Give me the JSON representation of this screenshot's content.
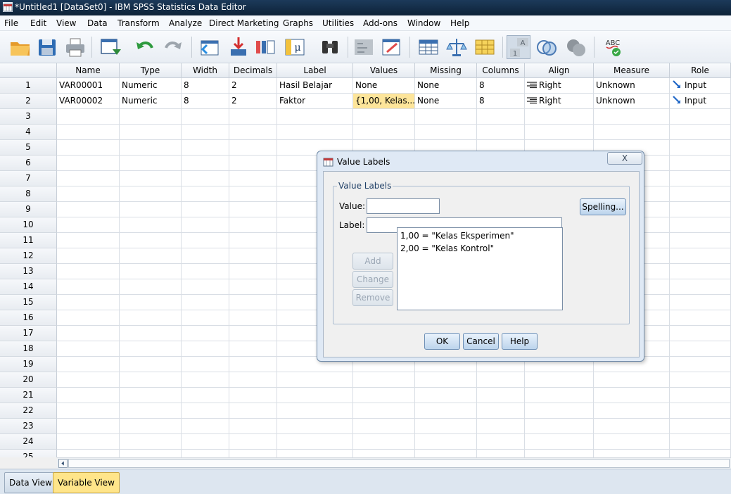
{
  "window": {
    "title": "*Untitled1 [DataSet0] - IBM SPSS Statistics Data Editor"
  },
  "menu": [
    "File",
    "Edit",
    "View",
    "Data",
    "Transform",
    "Analyze",
    "Direct Marketing",
    "Graphs",
    "Utilities",
    "Add-ons",
    "Window",
    "Help"
  ],
  "toolbar": {
    "buttons": [
      "open-folder",
      "save",
      "print",
      "dialog-recall",
      "undo",
      "redo",
      "go-to-case",
      "go-to-variable",
      "variables",
      "descriptive-statistics",
      "find",
      "insert-cases",
      "insert-variable",
      "split-file",
      "weight-cases",
      "select-cases",
      "value-labels",
      "use-sets",
      "show-all-variables",
      "spell-check"
    ]
  },
  "grid": {
    "columns": [
      "Name",
      "Type",
      "Width",
      "Decimals",
      "Label",
      "Values",
      "Missing",
      "Columns",
      "Align",
      "Measure",
      "Role"
    ],
    "rows": [
      [
        "VAR00001",
        "Numeric",
        "8",
        "2",
        "Hasil Belajar",
        "None",
        "None",
        "8",
        "Right",
        "Unknown",
        "Input"
      ],
      [
        "VAR00002",
        "Numeric",
        "8",
        "2",
        "Faktor",
        "{1,00, Kelas...",
        "None",
        "8",
        "Right",
        "Unknown",
        "Input"
      ]
    ],
    "row_numbers": [
      "1",
      "2",
      "3",
      "4",
      "5",
      "6",
      "7",
      "8",
      "9",
      "10",
      "11",
      "12",
      "13",
      "14",
      "15",
      "16",
      "17",
      "18",
      "19",
      "20",
      "21",
      "22",
      "23",
      "24",
      "25"
    ]
  },
  "tabs": {
    "data_view": "Data View",
    "variable_view": "Variable View"
  },
  "dialog": {
    "title": "Value Labels",
    "close_glyph": "X",
    "group_label": "Value Labels",
    "value_label": "Value:",
    "value_text": "",
    "label_label": "Label:",
    "label_text": "",
    "spelling": "Spelling...",
    "list": [
      "1,00 = \"Kelas Eksperimen\"",
      "2,00 = \"Kelas Kontrol\""
    ],
    "add": "Add",
    "change": "Change",
    "remove": "Remove",
    "ok": "OK",
    "cancel": "Cancel",
    "help": "Help"
  },
  "colors": {
    "highlight": "#fde59a",
    "active_tab": "#ffe58a",
    "dialog_bg": "#dfe9f5"
  }
}
